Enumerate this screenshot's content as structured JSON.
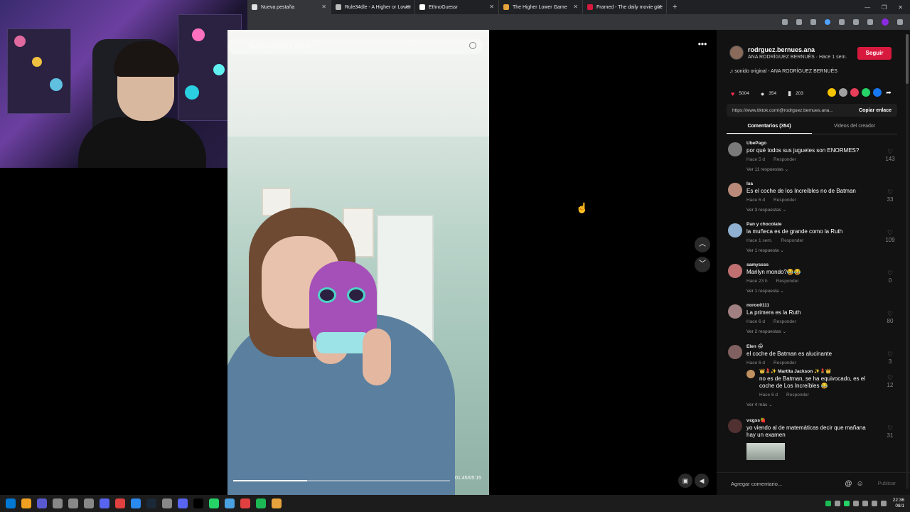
{
  "browser": {
    "tabs": [
      {
        "label": "Nueva pestaña",
        "active": true,
        "favicon_color": "#e0e0e0"
      },
      {
        "label": "Rule34dle - A Higher or Lower",
        "active": false,
        "favicon_color": "#bbbbbb"
      },
      {
        "label": "EthnoGuessr",
        "active": false,
        "favicon_color": "#ffffff"
      },
      {
        "label": "The Higher Lower Game",
        "active": false,
        "favicon_color": "#e8a33c"
      },
      {
        "label": "Framed - The daily movie gue",
        "active": false,
        "favicon_color": "#d8193e"
      }
    ],
    "new_tab_symbol": "+",
    "close_symbol": "✕",
    "window_controls": [
      "—",
      "❐",
      "✕"
    ]
  },
  "video": {
    "search_placeholder": "Buscar cuentas y videos",
    "time": "01:45/05:15",
    "progress": 0.34
  },
  "controls": {
    "more": "•••",
    "prev": "︿",
    "next": "﹀"
  },
  "panel": {
    "author_handle": "rodrguez.bernues.ana",
    "author_sub": "ANA RODRÍGUEZ BERNUÉS · Hace 1 sem.",
    "follow_label": "Seguir",
    "sound": "♫  sonido original - ANA RODRÍGUEZ BERNUÉS",
    "stats": {
      "likes": "5004",
      "comments": "354",
      "saves": "203"
    },
    "share_colors": [
      "#f5c400",
      "#a0a0a0",
      "#e83e5a",
      "#25d366",
      "#1877f2"
    ],
    "link": "https://www.tiktok.com/@rodrguez.bernues.ana...",
    "copy_label": "Copiar enlace",
    "tab_comments": "Comentarios (354)",
    "tab_creator": "Videos del creador",
    "add_comment_placeholder": "Agregar comentario...",
    "publish_label": "Publicar"
  },
  "comments": [
    {
      "user": "UbePago",
      "text": "por qué todos sus juguetes son ENORMES?",
      "time": "Hace 5 d",
      "reply": "Responder",
      "replies": "Ver 11 respuestas ⌄",
      "likes": "143",
      "avatar_color": "#7a7a7a"
    },
    {
      "user": "Isa",
      "text": "Es el coche de los Increíbles no de Batman",
      "time": "Hace 6 d",
      "reply": "Responder",
      "replies": "Ver 3 respuestas ⌄",
      "likes": "33",
      "avatar_color": "#b98a7a"
    },
    {
      "user": "Pan y chocolate",
      "text": "la muñeca es de grande como la Ruth",
      "time": "Hace 1 sem.",
      "reply": "Responder",
      "replies": "Ver 1 respuesta ⌄",
      "likes": "109",
      "avatar_color": "#8fb0d0"
    },
    {
      "user": "samyssss",
      "text": "Marilyn mondo?😂😂",
      "time": "Hace 23 h",
      "reply": "Responder",
      "replies": "Ver 1 respuesta ⌄",
      "likes": "0",
      "avatar_color": "#c07070"
    },
    {
      "user": "noroo0111",
      "text": "La primera es la Ruth",
      "time": "Hace 6 d",
      "reply": "Responder",
      "replies": "Ver 2 respuestas ⌄",
      "likes": "80",
      "avatar_color": "#a08080"
    },
    {
      "user": "Elen 🌧",
      "text": "el coche de Batman es alucinante",
      "time": "Hace 6 d",
      "reply": "Responder",
      "replies": "Ver 4 más ⌄",
      "likes": "3",
      "avatar_color": "#806060",
      "nested": {
        "user": "👑💄✨ Martita Jackson ✨💄👑",
        "text": "no es de Batman, se ha equivocado, es el coche de Los Increíbles 😂",
        "time": "Hace 6 d",
        "reply": "Responder",
        "likes": "12",
        "avatar_color": "#c09060"
      }
    },
    {
      "user": "ѵєgss🍓",
      "text": "yo viendo al de matemáticas decir que mañana hay un examen",
      "likes": "31",
      "avatar_color": "#503030"
    }
  ],
  "taskbar": {
    "app_colors": [
      "#0078d4",
      "#f0a020",
      "#5a5ad0",
      "#888888",
      "#888888",
      "#888888",
      "#5865f2",
      "#e04040",
      "#2a8af0",
      "#1b2838",
      "#888888",
      "#5865f2",
      "#000000",
      "#25d366",
      "#4aa0e0",
      "#e04040",
      "#1db954",
      "#e8a33c"
    ],
    "time": "22:36",
    "date": "08/1"
  }
}
